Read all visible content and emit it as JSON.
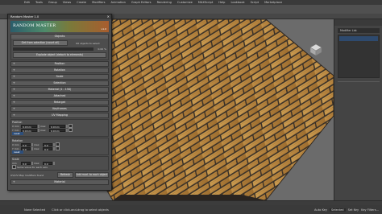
{
  "menu": {
    "items": [
      "Edit",
      "Tools",
      "Group",
      "Views",
      "Create",
      "Modifiers",
      "Animation",
      "Graph Editors",
      "Rendering",
      "Customize",
      "MAXScript",
      "Help",
      "Lookbook",
      "Script",
      "Marketplace"
    ]
  },
  "dialog": {
    "title": "Random Master 1.0",
    "close_glyph": "×",
    "banner_title": "RANDOM MASTER",
    "banner_version": "v1.0",
    "objects_header": "Objects",
    "get_from_selection": "Get from selection (count all)",
    "objects_count": "60 objects to select",
    "progress_pct": "0.00 %",
    "explode_label": "Explode object (detach to elements)",
    "rollouts": [
      "Position",
      "Rotation",
      "Scale",
      "Selection",
      "Material (1 - 150)",
      "Attached",
      "Retarget",
      "Keyframes",
      "UV Mapping"
    ],
    "rollout_sign": "+",
    "position_label": "Position",
    "rotation_label": "Rotation",
    "scale_label": "Scale",
    "axis_x": "X",
    "axis_y": "Y",
    "axis_z": "Z",
    "min_label": "min",
    "max_label": "max",
    "pos_x_min": "0.0mm",
    "pos_x_max": "0.0mm",
    "pos_y_min": "0.0mm",
    "pos_y_max": "0.0mm",
    "rot_x_min": "0.0",
    "rot_x_max": "0.0",
    "rot_y_min": "0.0",
    "rot_y_max": "0.0",
    "scale_min": "0.0",
    "scale_max": "0.0",
    "reset_label": "reset",
    "uniform_label": "Same value for each axis",
    "uv_map_label": "UV/UV Map modifiers found",
    "refresh_label": "Refresh",
    "add_mod_label": "Add mod. to each object",
    "material_footer": "Material"
  },
  "command_panel": {
    "modifier_list": "Modifier List"
  },
  "status": {
    "selected": "None Selected",
    "prompt": "Click or click-and-drag to select objects",
    "auto_key": "Auto Key",
    "selected_btn": "Selected",
    "set_key": "Set Key",
    "key_filters": "Key Filters..."
  },
  "brand": {
    "line1": "actionMan.eu",
    "line2": "Welcome to M"
  },
  "colors": {
    "wood_light": "#c89a4e",
    "wood_dark": "#8a5c24",
    "grout": "#3a3128",
    "accent_blue": "#2d4e7a"
  },
  "icons": {
    "viewcube": "viewcube-icon",
    "close": "close-icon"
  }
}
